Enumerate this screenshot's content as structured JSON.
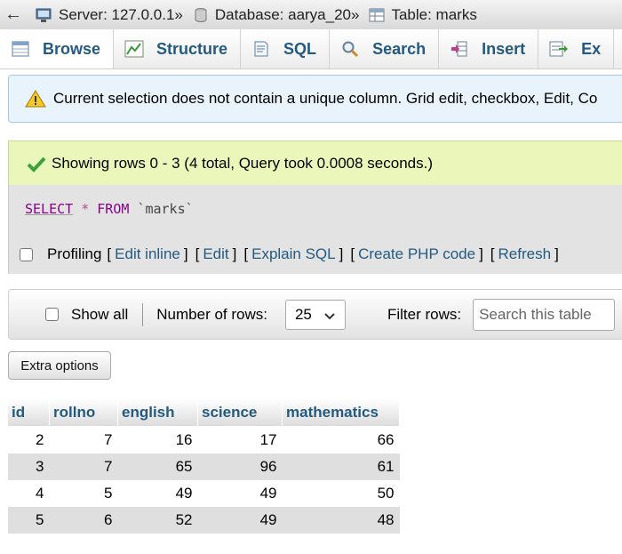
{
  "breadcrumb": {
    "back": "←",
    "server": "Server: 127.0.0.1",
    "database": "Database: aarya_20",
    "table": "Table: marks",
    "separator": "»"
  },
  "tabs": [
    {
      "label": "Browse",
      "icon": "browse-icon"
    },
    {
      "label": "Structure",
      "icon": "structure-icon"
    },
    {
      "label": "SQL",
      "icon": "sql-icon"
    },
    {
      "label": "Search",
      "icon": "search-icon"
    },
    {
      "label": "Insert",
      "icon": "insert-icon"
    },
    {
      "label": "Ex",
      "icon": "export-icon"
    }
  ],
  "notice": {
    "text": "Current selection does not contain a unique column. Grid edit, checkbox, Edit, Co",
    "icon": "warning-icon"
  },
  "success": {
    "text": "Showing rows 0 - 3 (4 total, Query took 0.0008 seconds.)",
    "icon": "check-icon"
  },
  "sql": {
    "select": "SELECT",
    "star": "*",
    "from": "FROM",
    "table": "`marks`"
  },
  "profiling": {
    "label": "Profiling",
    "open": "[",
    "close": "]",
    "links": [
      "Edit inline",
      "Edit",
      "Explain SQL",
      "Create PHP code",
      "Refresh"
    ]
  },
  "navigation": {
    "show_all": "Show all",
    "rows_label": "Number of rows:",
    "rows_value": "25",
    "filter_label": "Filter rows:",
    "filter_placeholder": "Search this table"
  },
  "extra_options": "Extra options",
  "table": {
    "columns": [
      "id",
      "rollno",
      "english",
      "science",
      "mathematics"
    ],
    "rows": [
      [
        "2",
        "7",
        "16",
        "17",
        "66"
      ],
      [
        "3",
        "7",
        "65",
        "96",
        "61"
      ],
      [
        "4",
        "5",
        "49",
        "49",
        "50"
      ],
      [
        "5",
        "6",
        "52",
        "49",
        "48"
      ]
    ]
  },
  "colors": {
    "link": "#235a81",
    "notice_bg": "#e8f3fb",
    "success_bg": "#ebf6ba",
    "sql_keyword": "#8b008b"
  }
}
